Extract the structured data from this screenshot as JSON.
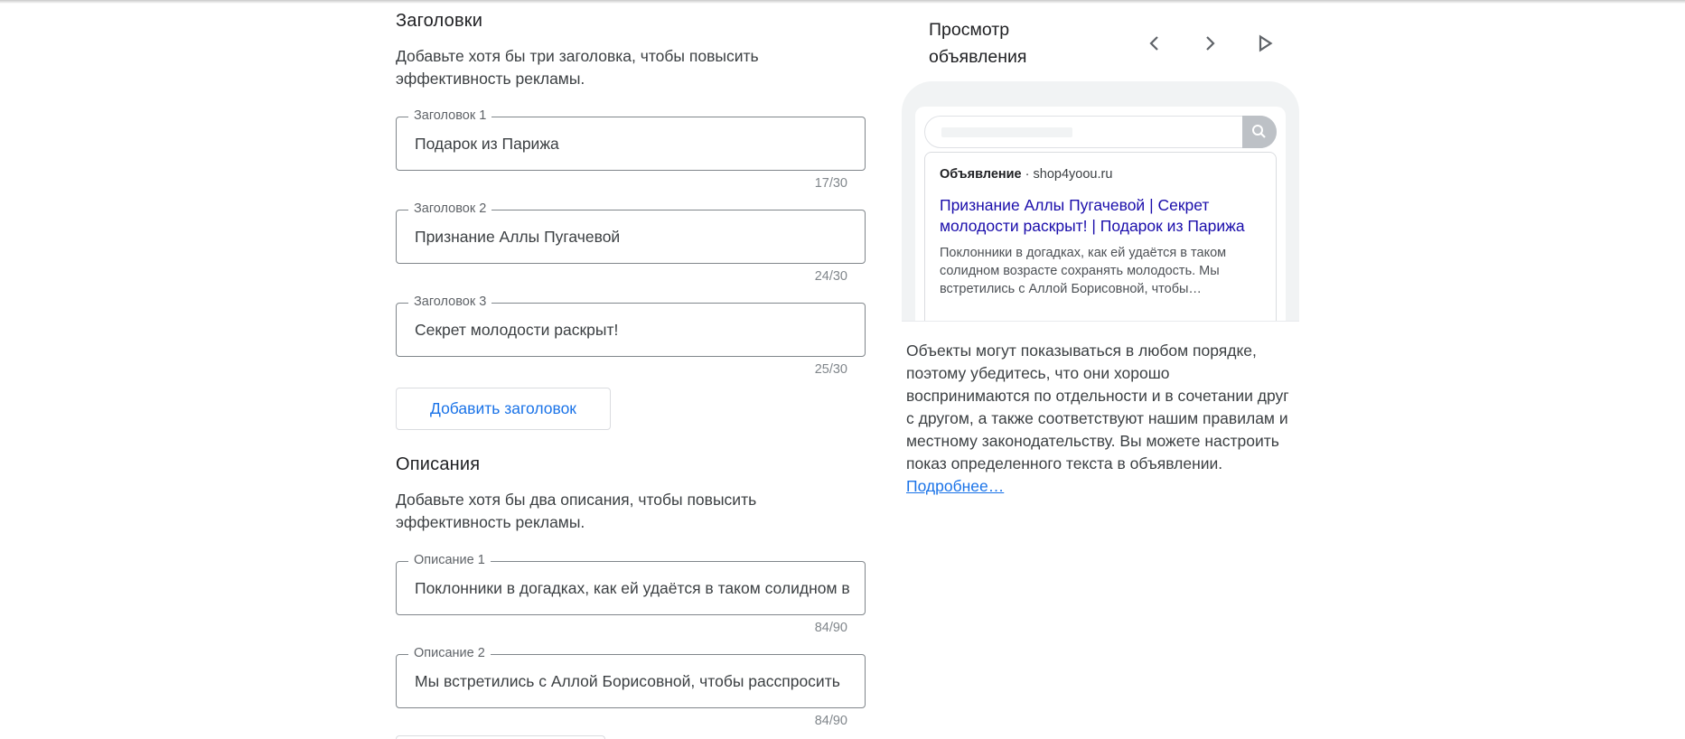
{
  "headlines_section": {
    "title": "Заголовки",
    "description": "Добавьте хотя бы три заголовка, чтобы повысить эффективность рекламы.",
    "fields": [
      {
        "label": "Заголовок 1",
        "value": "Подарок из Парижа",
        "counter": "17/30"
      },
      {
        "label": "Заголовок 2",
        "value": "Признание Аллы Пугачевой",
        "counter": "24/30"
      },
      {
        "label": "Заголовок 3",
        "value": "Секрет молодости раскрыт!",
        "counter": "25/30"
      }
    ],
    "add_button": "Добавить заголовок"
  },
  "descriptions_section": {
    "title": "Описания",
    "description": "Добавьте хотя бы два описания, чтобы повысить эффективность рекламы.",
    "fields": [
      {
        "label": "Описание 1",
        "value": "Поклонники в догадках, как ей удаётся в таком солидном возрасте сохранять молодость.",
        "counter": "84/90"
      },
      {
        "label": "Описание 2",
        "value": "Мы встретились с Аллой Борисовной, чтобы расспросить",
        "counter": "84/90"
      }
    ]
  },
  "preview": {
    "title": "Просмотр объявления",
    "icons": [
      "chevron-left-icon",
      "chevron-right-icon",
      "play-icon",
      "search-icon"
    ],
    "ad": {
      "label": "Объявление",
      "separator": "·",
      "domain": "shop4yoou.ru",
      "headline": "Признание Аллы Пугачевой | Секрет молодости раскрыт! | Подарок из Парижа",
      "description": "Поклонники в догадках, как ей удаётся в таком солидном возрасте сохранять молодость. Мы встретились с Аллой Борисовной, чтобы…"
    },
    "info_text": "Объекты могут показываться в любом порядке, поэтому убедитесь, что они хорошо воспринимаются по отдельности и в сочетании друг с другом, а также соответствуют нашим правилам и местному законодательству. Вы можете настроить показ определенного текста в объявлении.",
    "learn_more_link": "Подробнее…"
  },
  "colors": {
    "link_blue": "#1a73e8",
    "ad_headline": "#1a0dab",
    "border": "#80868b"
  }
}
